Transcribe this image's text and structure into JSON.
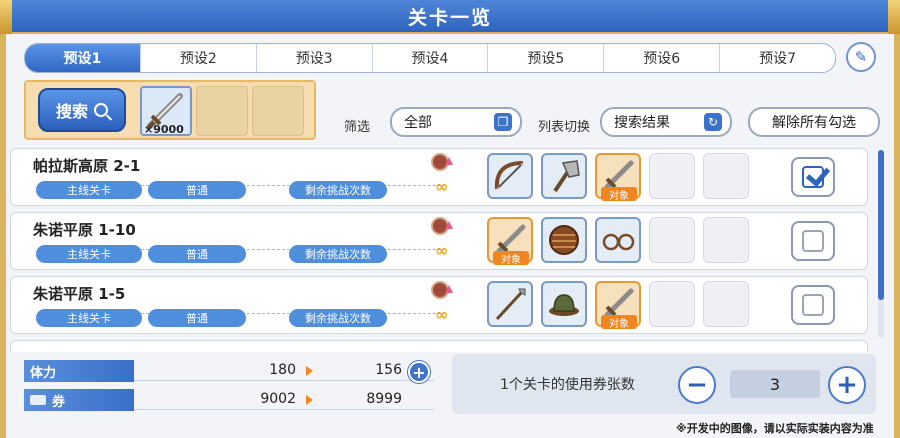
{
  "window": {
    "title": "关卡一览"
  },
  "tabs": [
    {
      "label": "预设1",
      "active": true
    },
    {
      "label": "预设2",
      "active": false
    },
    {
      "label": "预设3",
      "active": false
    },
    {
      "label": "预设4",
      "active": false
    },
    {
      "label": "预设5",
      "active": false
    },
    {
      "label": "预设6",
      "active": false
    },
    {
      "label": "预设7",
      "active": false
    }
  ],
  "search": {
    "button_label": "搜索",
    "item_count": "×9000"
  },
  "filter": {
    "filter_label": "筛选",
    "filter_value": "全部",
    "list_switch_label": "列表切换",
    "list_switch_value": "搜索结果",
    "clear_label": "解除所有勾选"
  },
  "stages": [
    {
      "name": "帕拉斯高原 2-1",
      "type": "主线关卡",
      "difficulty": "普通",
      "remaining": "剩余挑战次数",
      "remaining_value": "∞",
      "checked": true,
      "target_label": "对象"
    },
    {
      "name": "朱诺平原 1-10",
      "type": "主线关卡",
      "difficulty": "普通",
      "remaining": "剩余挑战次数",
      "remaining_value": "∞",
      "checked": false,
      "target_label": "对象"
    },
    {
      "name": "朱诺平原 1-5",
      "type": "主线关卡",
      "difficulty": "普通",
      "remaining": "剩余挑战次数",
      "remaining_value": "∞",
      "checked": false,
      "target_label": "对象"
    }
  ],
  "stamina": {
    "label": "体力",
    "current": "180",
    "after": "156"
  },
  "tickets": {
    "label": "券",
    "current": "9002",
    "after": "8999"
  },
  "ticket_use": {
    "label": "1个关卡的使用券张数",
    "value": "3"
  },
  "footnote": "※开发中的图像，请以实际实装内容为准",
  "colors": {
    "accent": "#2f67c4",
    "gold": "#d9b45e",
    "target": "#f1851f"
  }
}
